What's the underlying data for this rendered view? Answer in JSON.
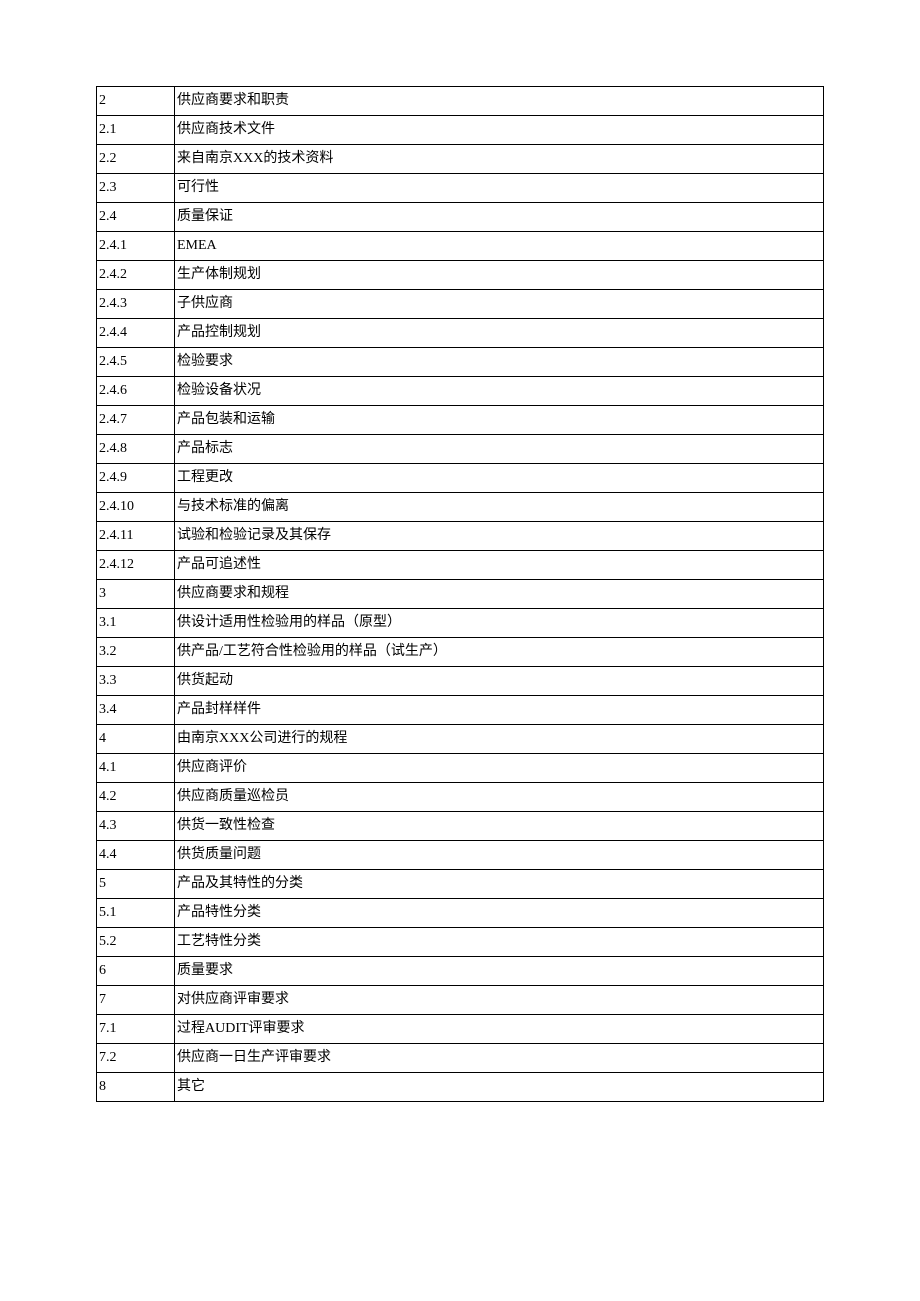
{
  "toc_rows": [
    {
      "num": "2",
      "title": "供应商要求和职责"
    },
    {
      "num": "2.1",
      "title": "供应商技术文件"
    },
    {
      "num": "2.2",
      "title": "来自南京XXX的技术资料"
    },
    {
      "num": "2.3",
      "title": "可行性"
    },
    {
      "num": "2.4",
      "title": "质量保证"
    },
    {
      "num": "2.4.1",
      "title": "EMEA"
    },
    {
      "num": "2.4.2",
      "title": "生产体制规划"
    },
    {
      "num": "2.4.3",
      "title": "子供应商"
    },
    {
      "num": "2.4.4",
      "title": "产品控制规划"
    },
    {
      "num": "2.4.5",
      "title": "检验要求"
    },
    {
      "num": "2.4.6",
      "title": "检验设备状况"
    },
    {
      "num": "2.4.7",
      "title": "产品包装和运输"
    },
    {
      "num": "2.4.8",
      "title": "产品标志"
    },
    {
      "num": "2.4.9",
      "title": "工程更改"
    },
    {
      "num": "2.4.10",
      "title": "与技术标准的偏离"
    },
    {
      "num": "2.4.11",
      "title": "试验和检验记录及其保存"
    },
    {
      "num": "2.4.12",
      "title": "产品可追述性"
    },
    {
      "num": "3",
      "title": "供应商要求和规程"
    },
    {
      "num": "3.1",
      "title": "供设计适用性检验用的样品（原型）"
    },
    {
      "num": "3.2",
      "title": "供产品/工艺符合性检验用的样品（试生产）"
    },
    {
      "num": "3.3",
      "title": "供货起动"
    },
    {
      "num": "3.4",
      "title": "产品封样样件"
    },
    {
      "num": "4",
      "title": "由南京XXX公司进行的规程"
    },
    {
      "num": "4.1",
      "title": "供应商评价"
    },
    {
      "num": "4.2",
      "title": "供应商质量巡检员"
    },
    {
      "num": "4.3",
      "title": "供货一致性检查"
    },
    {
      "num": "4.4",
      "title": "供货质量问题"
    },
    {
      "num": "5",
      "title": "产品及其特性的分类"
    },
    {
      "num": "5.1",
      "title": "产品特性分类"
    },
    {
      "num": "5.2",
      "title": "工艺特性分类"
    },
    {
      "num": "6",
      "title": "质量要求"
    },
    {
      "num": "7",
      "title": "对供应商评审要求"
    },
    {
      "num": "7.1",
      "title": "过程AUDIT评审要求"
    },
    {
      "num": "7.2",
      "title": "供应商一日生产评审要求"
    },
    {
      "num": "8",
      "title": "其它"
    }
  ]
}
